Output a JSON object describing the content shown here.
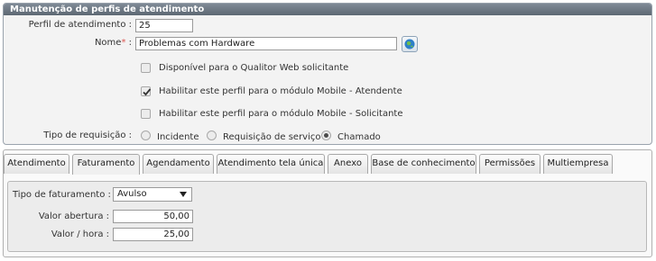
{
  "header": {
    "title": "Manutenção de perfis de atendimento"
  },
  "form": {
    "perfil_label": "Perfil de atendimento :",
    "perfil_value": "25",
    "nome_label": "Nome",
    "nome_required_mark": "*",
    "nome_colon": ":",
    "nome_value": "Problemas com Hardware",
    "checkboxes": [
      {
        "label": "Disponível para o Qualitor Web solicitante",
        "checked": false
      },
      {
        "label": "Habilitar este perfil para o módulo Mobile - Atendente",
        "checked": true
      },
      {
        "label": "Habilitar este perfil para o módulo Mobile - Solicitante",
        "checked": false
      }
    ],
    "tipo_requisicao_label": "Tipo de requisição :",
    "radios": [
      {
        "label": "Incidente",
        "selected": false
      },
      {
        "label": "Requisição de serviço",
        "selected": false
      },
      {
        "label": "Chamado",
        "selected": true
      }
    ]
  },
  "tabs": [
    {
      "label": "Atendimento",
      "active": false
    },
    {
      "label": "Faturamento",
      "active": true
    },
    {
      "label": "Agendamento",
      "active": false
    },
    {
      "label": "Atendimento tela única",
      "active": false
    },
    {
      "label": "Anexo",
      "active": false
    },
    {
      "label": "Base de conhecimento",
      "active": false
    },
    {
      "label": "Permissões",
      "active": false
    },
    {
      "label": "Multiempresa",
      "active": false
    }
  ],
  "faturamento": {
    "tipo_label": "Tipo de faturamento :",
    "tipo_value": "Avulso",
    "valor_abertura_label": "Valor abertura :",
    "valor_abertura_value": "50,00",
    "valor_hora_label": "Valor / hora :",
    "valor_hora_value": "25,00"
  },
  "colors": {
    "header_bg": "#6b7580",
    "required": "#d9534f"
  }
}
